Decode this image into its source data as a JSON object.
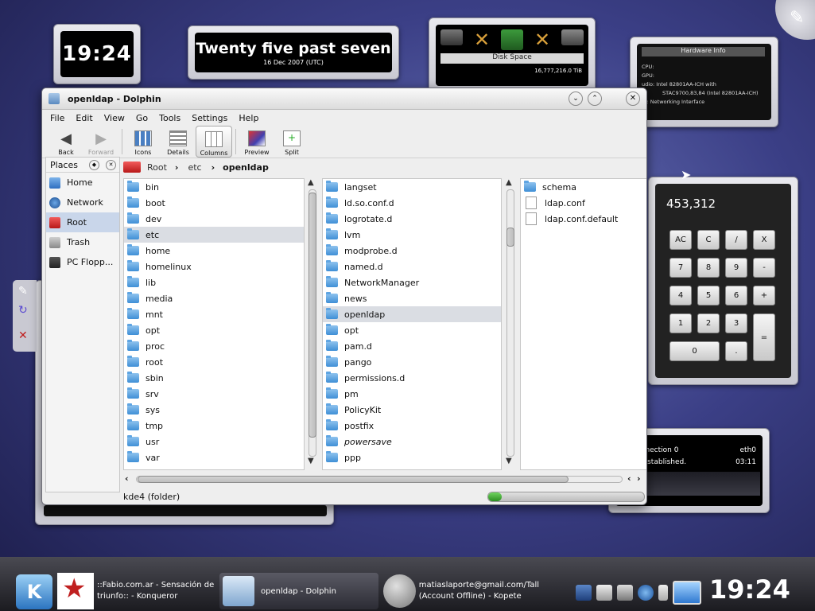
{
  "desktop": {
    "clock_small": "19:24",
    "clock_text": {
      "main": "Twenty five past seven",
      "date": "16 Dec 2007 (UTC)"
    },
    "disk_space": {
      "label": "Disk Space",
      "value": "16,777,216.0 TiB"
    },
    "hardware_info": {
      "title": "Hardware Info",
      "rows": [
        "CPU:",
        "GPU:",
        "udio: Intel 82801AA-ICH with",
        "STAC9700,83,84 (Intel 82801AA-ICH)",
        "et:    Networking Interface"
      ]
    },
    "calculator": {
      "display": "453,312",
      "keys": [
        [
          "AC",
          "C",
          "/",
          "X"
        ],
        [
          "7",
          "8",
          "9",
          "-"
        ],
        [
          "4",
          "5",
          "6",
          "+"
        ],
        [
          "1",
          "2",
          "3",
          "="
        ],
        [
          "0",
          "."
        ]
      ]
    },
    "network": {
      "line1_left": "ork connection 0",
      "line1_right": "eth0",
      "line2_left": "ection established.",
      "line2_right": "03:11"
    }
  },
  "window": {
    "title": "openldap - Dolphin",
    "menu": [
      "File",
      "Edit",
      "View",
      "Go",
      "Tools",
      "Settings",
      "Help"
    ],
    "toolbar": [
      "Back",
      "Forward",
      "Icons",
      "Details",
      "Columns",
      "Preview",
      "Split"
    ],
    "places": {
      "title": "Places",
      "items": [
        "Home",
        "Network",
        "Root",
        "Trash",
        "PC Flopp..."
      ]
    },
    "breadcrumb": [
      "Root",
      "etc",
      "openldap"
    ],
    "columns": {
      "col1": [
        "bin",
        "boot",
        "dev",
        "etc",
        "home",
        "homelinux",
        "lib",
        "media",
        "mnt",
        "opt",
        "proc",
        "root",
        "sbin",
        "srv",
        "sys",
        "tmp",
        "usr",
        "var"
      ],
      "col2": [
        "langset",
        "ld.so.conf.d",
        "logrotate.d",
        "lvm",
        "modprobe.d",
        "named.d",
        "NetworkManager",
        "news",
        "openldap",
        "opt",
        "pam.d",
        "pango",
        "permissions.d",
        "pm",
        "PolicyKit",
        "postfix",
        "powersave",
        "ppp"
      ],
      "col3": [
        "schema",
        "ldap.conf",
        "ldap.conf.default"
      ]
    },
    "status": "kde4 (folder)"
  },
  "taskbar": {
    "tasks": [
      {
        "line1": "::Fabio.com.ar - Sensación de",
        "line2": "triunfo:: - Konqueror"
      },
      {
        "line1": "openldap - Dolphin",
        "line2": ""
      },
      {
        "line1": "matiaslaporte@gmail.com/Tall",
        "line2": "(Account Offline) - Kopete"
      }
    ],
    "clock": "19:24"
  },
  "colors": {
    "selection": "#c9d6ea",
    "folder": "#3f8fd6",
    "taskbar": "#1b1b20"
  }
}
